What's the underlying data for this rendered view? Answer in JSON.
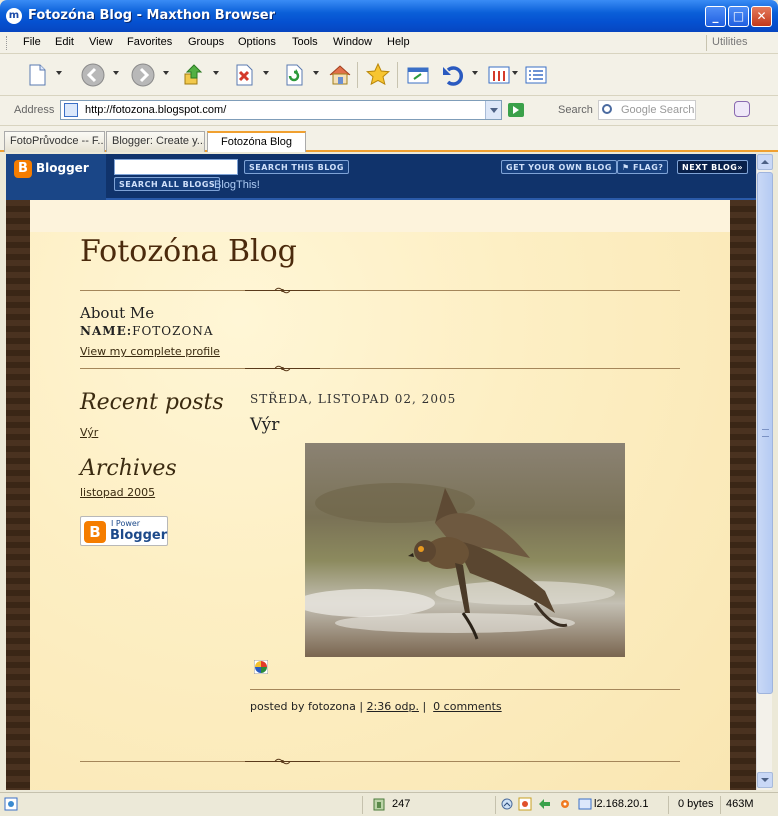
{
  "window": {
    "title": "Fotozóna Blog - Maxthon Browser",
    "app_icon": "m"
  },
  "menu": {
    "items": [
      "File",
      "Edit",
      "View",
      "Favorites",
      "Groups",
      "Options",
      "Tools",
      "Window",
      "Help"
    ],
    "utilities": "Utilities"
  },
  "address": {
    "label": "Address",
    "url": "http://fotozona.blogspot.com/",
    "search_label": "Search",
    "search_placeholder": "Google Search"
  },
  "tabs": [
    {
      "label": "FotoPrůvodce -- F..."
    },
    {
      "label": "Blogger: Create y..."
    },
    {
      "label": "Fotozóna Blog",
      "active": true
    }
  ],
  "navbar": {
    "logo": "Blogger",
    "search_this_blog": "SEARCH THIS BLOG",
    "search_all_blogs": "SEARCH ALL BLOGS",
    "blogthis": "BlogThis!",
    "get_your_own_blog": "GET YOUR OWN BLOG",
    "flag": "FLAG?",
    "next_blog": "NEXT BLOG»"
  },
  "blog": {
    "title": "Fotozóna Blog",
    "about_heading": "About Me",
    "name_label": "NAME:",
    "name_value": "FOTOZONA",
    "profile_link": "View my complete profile",
    "recent_posts_heading": "Recent posts",
    "recent_posts": [
      "Výr"
    ],
    "archives_heading": "Archives",
    "archives": [
      "listopad 2005"
    ],
    "power_badge_small": "I Power",
    "power_badge_big": "Blogger"
  },
  "post": {
    "date": "STŘEDA, LISTOPAD 02, 2005",
    "title": "Výr",
    "footer_prefix": "posted by fotozona |",
    "time_link": "2:36 odp.",
    "separator": "|",
    "comments_link": "0 comments"
  },
  "status": {
    "count": "247",
    "ip": "l2.168.20.1",
    "bytes": "0 bytes",
    "memory": "463M"
  },
  "colors": {
    "title_bar": "#0550d0",
    "blogger_orange": "#f57d00",
    "navbar_blue": "#10336b",
    "tab_accent": "#f0a030",
    "blog_title": "#4b2a0c"
  }
}
